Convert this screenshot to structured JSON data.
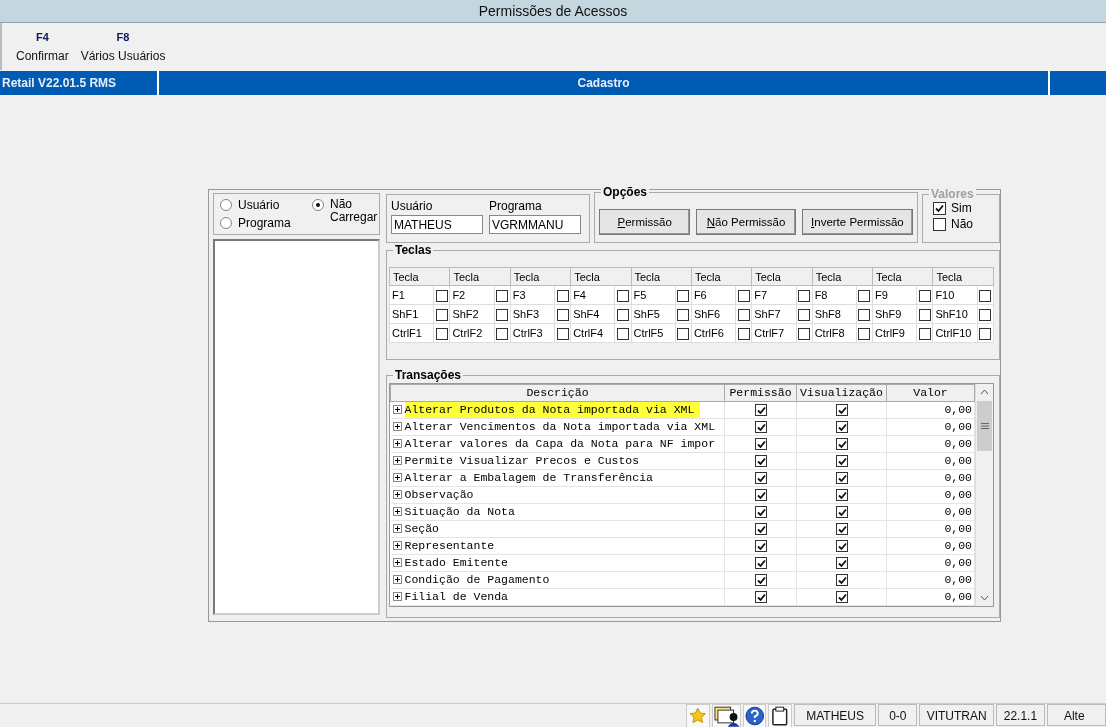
{
  "window": {
    "title": "Permissões de Acessos"
  },
  "toolbar": [
    {
      "key": "F4",
      "label": "Confirmar"
    },
    {
      "key": "F8",
      "label": "Vários Usuários"
    }
  ],
  "header_bar": {
    "left": "Retail V22.01.5 RMS",
    "center": "Cadastro"
  },
  "load_mode": [
    {
      "label": "Usuário",
      "selected": false
    },
    {
      "label": "Programa",
      "selected": false
    },
    {
      "label": "Não Carregar",
      "selected": true
    }
  ],
  "fields": [
    {
      "label": "Usuário",
      "value": "MATHEUS"
    },
    {
      "label": "Programa",
      "value": "VGRMMANU"
    }
  ],
  "options": {
    "title": "Opções",
    "buttons": [
      "Permissão",
      "Não Permissão",
      "Inverte Permissão"
    ]
  },
  "valores": {
    "title": "Valores",
    "disabled": true,
    "items": [
      {
        "label": "Sim",
        "checked": true
      },
      {
        "label": "Não",
        "checked": false
      }
    ]
  },
  "teclas": {
    "title": "Teclas",
    "headers": [
      "Tecla",
      "Tecla",
      "Tecla",
      "Tecla",
      "Tecla",
      "Tecla",
      "Tecla",
      "Tecla",
      "Tecla",
      "Tecla"
    ],
    "rows": [
      [
        {
          "key": "F1",
          "checked": false
        },
        {
          "key": "F2",
          "checked": false
        },
        {
          "key": "F3",
          "checked": false
        },
        {
          "key": "F4",
          "checked": false
        },
        {
          "key": "F5",
          "checked": false
        },
        {
          "key": "F6",
          "checked": false
        },
        {
          "key": "F7",
          "checked": false
        },
        {
          "key": "F8",
          "checked": false
        },
        {
          "key": "F9",
          "checked": false
        },
        {
          "key": "F10",
          "checked": false
        }
      ],
      [
        {
          "key": "ShF1",
          "checked": false
        },
        {
          "key": "ShF2",
          "checked": false
        },
        {
          "key": "ShF3",
          "checked": false
        },
        {
          "key": "ShF4",
          "checked": false
        },
        {
          "key": "ShF5",
          "checked": false
        },
        {
          "key": "ShF6",
          "checked": false
        },
        {
          "key": "ShF7",
          "checked": false
        },
        {
          "key": "ShF8",
          "checked": false
        },
        {
          "key": "ShF9",
          "checked": false
        },
        {
          "key": "ShF10",
          "checked": false
        }
      ],
      [
        {
          "key": "CtrlF1",
          "checked": false
        },
        {
          "key": "CtrlF2",
          "checked": false
        },
        {
          "key": "CtrlF3",
          "checked": false
        },
        {
          "key": "CtrlF4",
          "checked": false
        },
        {
          "key": "CtrlF5",
          "checked": false
        },
        {
          "key": "CtrlF6",
          "checked": false
        },
        {
          "key": "CtrlF7",
          "checked": false
        },
        {
          "key": "CtrlF8",
          "checked": false
        },
        {
          "key": "CtrlF9",
          "checked": false
        },
        {
          "key": "CtrlF10",
          "checked": false
        }
      ]
    ]
  },
  "transacoes": {
    "title": "Transações",
    "columns": [
      "Descrição",
      "Permissão",
      "Visualização",
      "Valor"
    ],
    "rows": [
      {
        "description": "Alterar Produtos da Nota importada via XML",
        "permissao": true,
        "visualizacao": true,
        "valor": "0,00",
        "highlighted": true
      },
      {
        "description": "Alterar Vencimentos da Nota importada via XML",
        "permissao": true,
        "visualizacao": true,
        "valor": "0,00",
        "highlighted": false
      },
      {
        "description": "Alterar valores da Capa da Nota para NF impor",
        "permissao": true,
        "visualizacao": true,
        "valor": "0,00",
        "highlighted": false
      },
      {
        "description": "Permite Visualizar Precos e Custos",
        "permissao": true,
        "visualizacao": true,
        "valor": "0,00",
        "highlighted": false
      },
      {
        "description": "Alterar a Embalagem de Transferência",
        "permissao": true,
        "visualizacao": true,
        "valor": "0,00",
        "highlighted": false
      },
      {
        "description": "Observação",
        "permissao": true,
        "visualizacao": true,
        "valor": "0,00",
        "highlighted": false
      },
      {
        "description": "Situação da Nota",
        "permissao": true,
        "visualizacao": true,
        "valor": "0,00",
        "highlighted": false
      },
      {
        "description": "Seção",
        "permissao": true,
        "visualizacao": true,
        "valor": "0,00",
        "highlighted": false
      },
      {
        "description": "Representante",
        "permissao": true,
        "visualizacao": true,
        "valor": "0,00",
        "highlighted": false
      },
      {
        "description": "Estado Emitente",
        "permissao": true,
        "visualizacao": true,
        "valor": "0,00",
        "highlighted": false
      },
      {
        "description": "Condição de Pagamento",
        "permissao": true,
        "visualizacao": true,
        "valor": "0,00",
        "highlighted": false
      },
      {
        "description": "Filial de Venda",
        "permissao": true,
        "visualizacao": true,
        "valor": "0,00",
        "highlighted": false
      }
    ]
  },
  "status_bar": [
    "MATHEUS",
    "0-0",
    "VITUTRAN",
    "22.1.1",
    "Alte"
  ]
}
